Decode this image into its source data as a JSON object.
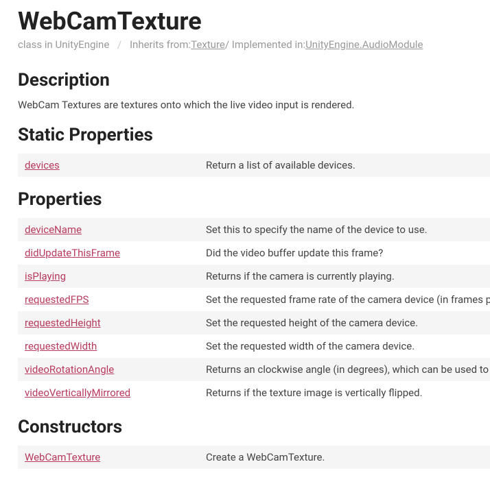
{
  "title": "WebCamTexture",
  "breadcrumb": {
    "classIn": "class in UnityEngine",
    "inheritsLabel": "Inherits from:",
    "inheritsLink": "Texture",
    "implementedLabel": "Implemented in:",
    "implementedLink": "UnityEngine.AudioModule"
  },
  "sections": {
    "descriptionHeading": "Description",
    "descriptionText": "WebCam Textures are textures onto which the live video input is rendered.",
    "staticPropsHeading": "Static Properties",
    "propsHeading": "Properties",
    "constructorsHeading": "Constructors"
  },
  "staticProperties": [
    {
      "name": "devices",
      "desc": "Return a list of available devices."
    }
  ],
  "properties": [
    {
      "name": "deviceName",
      "desc": "Set this to specify the name of the device to use."
    },
    {
      "name": "didUpdateThisFrame",
      "desc": "Did the video buffer update this frame?"
    },
    {
      "name": "isPlaying",
      "desc": "Returns if the camera is currently playing."
    },
    {
      "name": "requestedFPS",
      "desc": "Set the requested frame rate of the camera device (in frames per second)."
    },
    {
      "name": "requestedHeight",
      "desc": "Set the requested height of the camera device."
    },
    {
      "name": "requestedWidth",
      "desc": "Set the requested width of the camera device."
    },
    {
      "name": "videoRotationAngle",
      "desc": "Returns an clockwise angle (in degrees), which can be used to rotate."
    },
    {
      "name": "videoVerticallyMirrored",
      "desc": "Returns if the texture image is vertically flipped."
    }
  ],
  "constructors": [
    {
      "name": "WebCamTexture",
      "desc": "Create a WebCamTexture."
    }
  ]
}
